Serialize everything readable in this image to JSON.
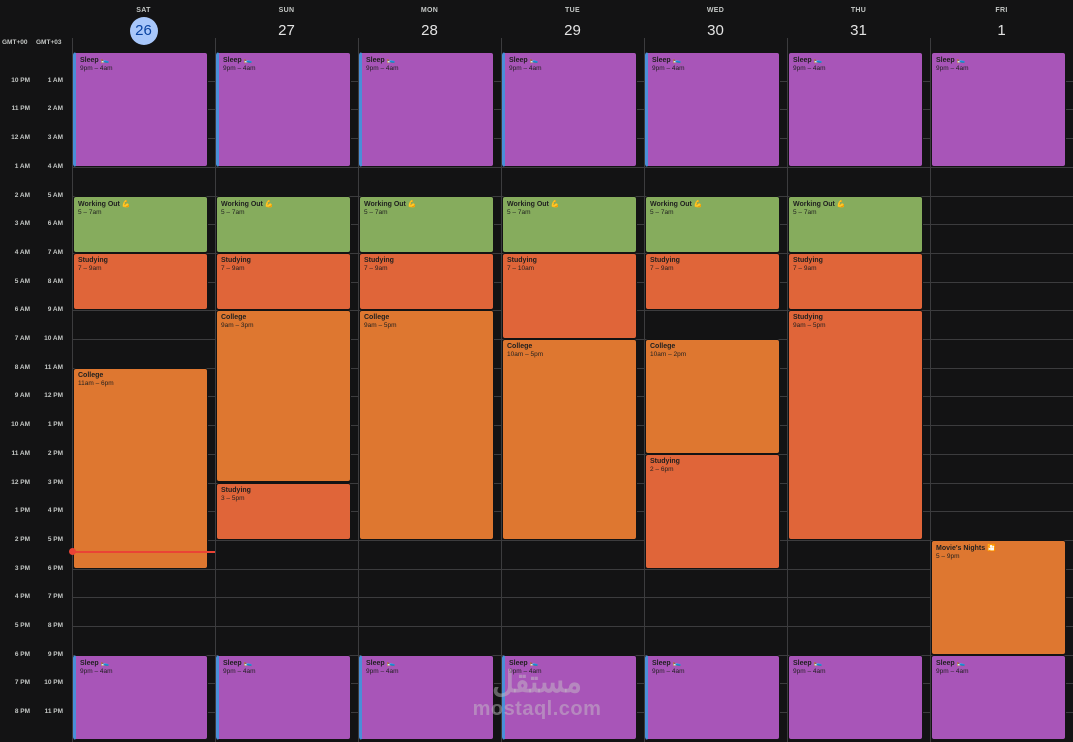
{
  "timezones": {
    "primary": "GMT+00",
    "secondary": "GMT+03"
  },
  "days": [
    {
      "name": "SAT",
      "num": "26",
      "today": true
    },
    {
      "name": "SUN",
      "num": "27",
      "today": false
    },
    {
      "name": "MON",
      "num": "28",
      "today": false
    },
    {
      "name": "TUE",
      "num": "29",
      "today": false
    },
    {
      "name": "WED",
      "num": "30",
      "today": false
    },
    {
      "name": "THU",
      "num": "31",
      "today": false
    },
    {
      "name": "FRI",
      "num": "1",
      "today": false
    }
  ],
  "hours_primary": [
    "10 PM",
    "11 PM",
    "12 AM",
    "1 AM",
    "2 AM",
    "3 AM",
    "4 AM",
    "5 AM",
    "6 AM",
    "7 AM",
    "8 AM",
    "9 AM",
    "10 AM",
    "11 AM",
    "12 PM",
    "1 PM",
    "2 PM",
    "3 PM",
    "4 PM",
    "5 PM",
    "6 PM",
    "7 PM",
    "8 PM"
  ],
  "hours_secondary": [
    "1 AM",
    "2 AM",
    "3 AM",
    "4 AM",
    "5 AM",
    "6 AM",
    "7 AM",
    "8 AM",
    "9 AM",
    "10 AM",
    "11 AM",
    "12 PM",
    "1 PM",
    "2 PM",
    "3 PM",
    "4 PM",
    "5 PM",
    "6 PM",
    "7 PM",
    "8 PM",
    "9 PM",
    "10 PM",
    "11 PM"
  ],
  "colors": {
    "sleep": "#a855b8",
    "workout": "#86ac5d",
    "studying": "#e06539",
    "college": "#de7730",
    "movie": "#de7730",
    "today_circle": "#a8c7fa",
    "now_indicator": "#ea4335"
  },
  "events": [
    {
      "day": 0,
      "title": "Sleep 🛌",
      "time": "9pm – 4am",
      "start": 0,
      "end": 4,
      "kind": "sleep"
    },
    {
      "day": 1,
      "title": "Sleep 🛌",
      "time": "9pm – 4am",
      "start": 0,
      "end": 4,
      "kind": "sleep"
    },
    {
      "day": 2,
      "title": "Sleep 🛌",
      "time": "9pm – 4am",
      "start": 0,
      "end": 4,
      "kind": "sleep"
    },
    {
      "day": 3,
      "title": "Sleep 🛌",
      "time": "9pm – 4am",
      "start": 0,
      "end": 4,
      "kind": "sleep"
    },
    {
      "day": 4,
      "title": "Sleep 🛌",
      "time": "9pm – 4am",
      "start": 0,
      "end": 4,
      "kind": "sleep"
    },
    {
      "day": 5,
      "title": "Sleep 🛌",
      "time": "9pm – 4am",
      "start": 0,
      "end": 4,
      "kind": "sleep"
    },
    {
      "day": 6,
      "title": "Sleep 🛌",
      "time": "9pm – 4am",
      "start": 0,
      "end": 4,
      "kind": "sleep"
    },
    {
      "day": 0,
      "title": "Working Out 💪",
      "time": "5 – 7am",
      "start": 5,
      "end": 7,
      "kind": "workout"
    },
    {
      "day": 1,
      "title": "Working Out 💪",
      "time": "5 – 7am",
      "start": 5,
      "end": 7,
      "kind": "workout"
    },
    {
      "day": 2,
      "title": "Working Out 💪",
      "time": "5 – 7am",
      "start": 5,
      "end": 7,
      "kind": "workout"
    },
    {
      "day": 3,
      "title": "Working Out 💪",
      "time": "5 – 7am",
      "start": 5,
      "end": 7,
      "kind": "workout"
    },
    {
      "day": 4,
      "title": "Working Out 💪",
      "time": "5 – 7am",
      "start": 5,
      "end": 7,
      "kind": "workout"
    },
    {
      "day": 5,
      "title": "Working Out 💪",
      "time": "5 – 7am",
      "start": 5,
      "end": 7,
      "kind": "workout"
    },
    {
      "day": 0,
      "title": "Studying",
      "time": "7 – 9am",
      "start": 7,
      "end": 9,
      "kind": "studying"
    },
    {
      "day": 1,
      "title": "Studying",
      "time": "7 – 9am",
      "start": 7,
      "end": 9,
      "kind": "studying"
    },
    {
      "day": 2,
      "title": "Studying",
      "time": "7 – 9am",
      "start": 7,
      "end": 9,
      "kind": "studying"
    },
    {
      "day": 3,
      "title": "Studying",
      "time": "7 – 10am",
      "start": 7,
      "end": 10,
      "kind": "studying"
    },
    {
      "day": 4,
      "title": "Studying",
      "time": "7 – 9am",
      "start": 7,
      "end": 9,
      "kind": "studying"
    },
    {
      "day": 5,
      "title": "Studying",
      "time": "7 – 9am",
      "start": 7,
      "end": 9,
      "kind": "studying"
    },
    {
      "day": 0,
      "title": "College",
      "time": "11am – 6pm",
      "start": 11,
      "end": 18,
      "kind": "college"
    },
    {
      "day": 1,
      "title": "College",
      "time": "9am – 3pm",
      "start": 9,
      "end": 15,
      "kind": "college"
    },
    {
      "day": 1,
      "title": "Studying",
      "time": "3 – 5pm",
      "start": 15,
      "end": 17,
      "kind": "studying"
    },
    {
      "day": 2,
      "title": "College",
      "time": "9am – 5pm",
      "start": 9,
      "end": 17,
      "kind": "college"
    },
    {
      "day": 3,
      "title": "College",
      "time": "10am – 5pm",
      "start": 10,
      "end": 17,
      "kind": "college"
    },
    {
      "day": 4,
      "title": "College",
      "time": "10am – 2pm",
      "start": 10,
      "end": 14,
      "kind": "college"
    },
    {
      "day": 4,
      "title": "Studying",
      "time": "2 – 6pm",
      "start": 14,
      "end": 18,
      "kind": "studying"
    },
    {
      "day": 5,
      "title": "Studying",
      "time": "9am – 5pm",
      "start": 9,
      "end": 17,
      "kind": "studying"
    },
    {
      "day": 6,
      "title": "Movie's Nights 🎦",
      "time": "5 – 9pm",
      "start": 17,
      "end": 21,
      "kind": "movie"
    },
    {
      "day": 0,
      "title": "Sleep 🛌",
      "time": "9pm – 4am",
      "start": 21,
      "end": 24,
      "kind": "sleep"
    },
    {
      "day": 1,
      "title": "Sleep 🛌",
      "time": "9pm – 4am",
      "start": 21,
      "end": 24,
      "kind": "sleep"
    },
    {
      "day": 2,
      "title": "Sleep 🛌",
      "time": "9pm – 4am",
      "start": 21,
      "end": 24,
      "kind": "sleep"
    },
    {
      "day": 3,
      "title": "Sleep 🛌",
      "time": "9pm – 4am",
      "start": 21,
      "end": 24,
      "kind": "sleep"
    },
    {
      "day": 4,
      "title": "Sleep 🛌",
      "time": "9pm – 4am",
      "start": 21,
      "end": 24,
      "kind": "sleep"
    },
    {
      "day": 5,
      "title": "Sleep 🛌",
      "time": "9pm – 4am",
      "start": 21,
      "end": 24,
      "kind": "sleep"
    },
    {
      "day": 6,
      "title": "Sleep 🛌",
      "time": "9pm – 4am",
      "start": 21,
      "end": 24,
      "kind": "sleep"
    }
  ],
  "now": {
    "day": 0,
    "hour": 17.4
  },
  "watermark": {
    "logo": "مستقل",
    "text": "mostaql.com"
  }
}
